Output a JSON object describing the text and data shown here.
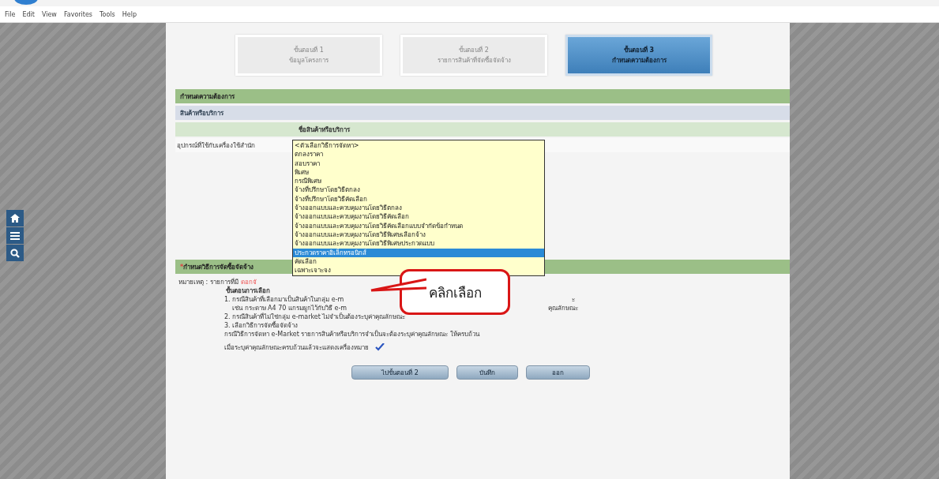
{
  "menu_bar": [
    "File",
    "Edit",
    "View",
    "Favorites",
    "Tools",
    "Help"
  ],
  "side_nav": [
    {
      "kind": "home"
    },
    {
      "kind": "menu"
    },
    {
      "kind": "search"
    }
  ],
  "steps": [
    {
      "title": "ขั้นตอนที่ 1",
      "subtitle": "ข้อมูลโครงการ",
      "selected": false
    },
    {
      "title": "ขั้นตอนที่ 2",
      "subtitle": "รายการสินค้าที่จัดซื้อจัดจ้าง",
      "selected": false
    },
    {
      "title": "ขั้นตอนที่ 3",
      "subtitle": "กำหนดความต้องการ",
      "selected": true
    }
  ],
  "section_title": "กำหนดความต้องการ",
  "subsection_title": "สินค้าหรือบริการ",
  "table": {
    "column_header": "ชื่อสินค้าหรือบริการ",
    "row": "อุปกรณ์ที่ใช้กับเครื่องใช้สำนัก"
  },
  "dropdown": {
    "options": [
      {
        "label": "<ตัวเลือกวิธีการจัดหา>",
        "selected": false
      },
      {
        "label": "ตกลงราคา",
        "selected": false
      },
      {
        "label": "สอบราคา",
        "selected": false
      },
      {
        "label": "พิเศษ",
        "selected": false
      },
      {
        "label": "กรณีพิเศษ",
        "selected": false
      },
      {
        "label": "จ้างที่ปรึกษาโดยวิธีตกลง",
        "selected": false
      },
      {
        "label": "จ้างที่ปรึกษาโดยวิธีคัดเลือก",
        "selected": false
      },
      {
        "label": "จ้างออกแบบและควบคุมงานโดยวิธีตกลง",
        "selected": false
      },
      {
        "label": "จ้างออกแบบและควบคุมงานโดยวิธีคัดเลือก",
        "selected": false
      },
      {
        "label": "จ้างออกแบบและควบคุมงานโดยวิธีคัดเลือกแบบจำกัดข้อกำหนด",
        "selected": false
      },
      {
        "label": "จ้างออกแบบและควบคุมงานโดยวิธีพิเศษเลือกจ้าง",
        "selected": false
      },
      {
        "label": "จ้างออกแบบและควบคุมงานโดยวิธีพิเศษประกวดแบบ",
        "selected": false
      },
      {
        "label": "ประกวดราคาอิเล็กทรอนิกส์",
        "selected": true
      },
      {
        "label": "คัดเลือก",
        "selected": false
      },
      {
        "label": "เฉพาะเจาะจง",
        "selected": false
      }
    ]
  },
  "method_title": "กำหนดวิธีการจัดซื้อจัดจ้าง",
  "required_mark": "*",
  "notes": {
    "label": "หมายเหตุ : รายการที่มี",
    "highlight": "ดอกจั",
    "lines": [
      {
        "left": "ขั้นตอนการเลือก",
        "kind": "heading"
      },
      {
        "left": "1. กรณีสินค้าที่เลือกมาเป็นสินค้าในกลุ่ม e-m",
        "right": "ะ",
        "kind": "item"
      },
      {
        "left": "เช่น กระดาษ A4 70 แกรมผูกไว้กับวิธี e-m",
        "right": "คุณลักษณะ",
        "kind": "sub"
      },
      {
        "left": "2. กรณีสินค้าที่ไม่ใช่กลุ่ม e-market ไม่จำเป็นต้องระบุค่าคุณลักษณะ",
        "kind": "item"
      },
      {
        "left": "3. เลือกวิธีการจัดซื้อจัดจ้าง",
        "kind": "item"
      },
      {
        "left": "กรณีวิธีการจัดหา e-Market รายการสินค้าหรือบริการจำเป็นจะต้องระบุค่าคุณลักษณะ ให้ครบถ้วน",
        "kind": "item"
      }
    ],
    "check_line": "เมื่อระบุค่าคุณลักษณะครบถ้วนแล้วจะแสดงเครื่องหมาย"
  },
  "buttons": [
    "ไปขั้นตอนที่ 2",
    "บันทึก",
    "ออก"
  ],
  "callout": "คลิกเลือก"
}
